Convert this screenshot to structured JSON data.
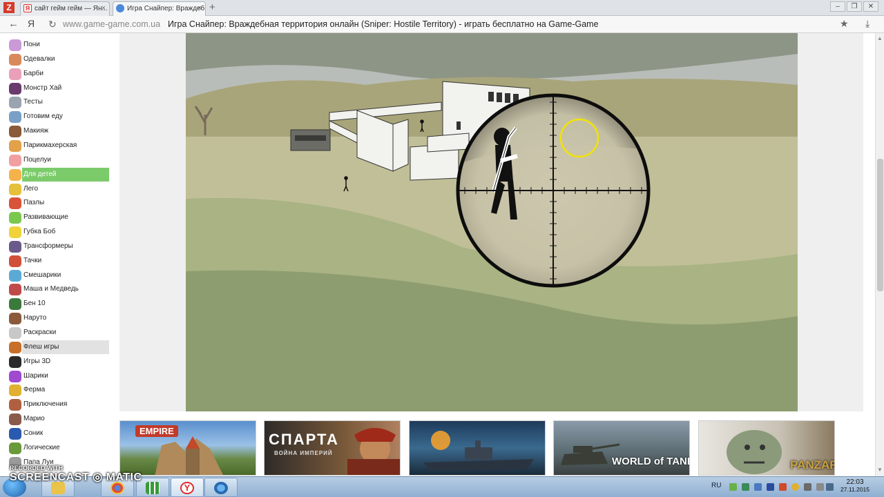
{
  "browser": {
    "tabs": [
      {
        "label": "сайт гейм гейм — Ян..."
      },
      {
        "label": "Игра Снайпер: Враждеб"
      }
    ],
    "url": "www.game-game.com.ua",
    "page_title": "Игра Снайпер: Враждебная территория онлайн (Sniper: Hostile Territory) - играть бесплатно на Game-Game"
  },
  "sidebar": {
    "items": [
      {
        "label": "Пони",
        "icon": "pony-icon",
        "color": "#c99ad6"
      },
      {
        "label": "Одевалки",
        "icon": "dress-up-icon",
        "color": "#d98a5a"
      },
      {
        "label": "Барби",
        "icon": "barbie-icon",
        "color": "#e9a0b8"
      },
      {
        "label": "Монстр Хай",
        "icon": "monster-high-icon",
        "color": "#6a3a6e"
      },
      {
        "label": "Тесты",
        "icon": "tests-icon",
        "color": "#9aa4b0"
      },
      {
        "label": "Готовим еду",
        "icon": "cooking-icon",
        "color": "#7aa0c8"
      },
      {
        "label": "Макияж",
        "icon": "makeup-icon",
        "color": "#8a5a3a"
      },
      {
        "label": "Парикмахерская",
        "icon": "scissors-icon",
        "color": "#e3a14a"
      },
      {
        "label": "Поцелуи",
        "icon": "kisses-icon",
        "color": "#f0a0a0"
      },
      {
        "label": "Для детей",
        "icon": "kids-icon",
        "color": "#f4b24a"
      },
      {
        "label": "Лего",
        "icon": "lego-icon",
        "color": "#e5c03a"
      },
      {
        "label": "Пазлы",
        "icon": "puzzle-icon",
        "color": "#d9533a"
      },
      {
        "label": "Развивающие",
        "icon": "educational-icon",
        "color": "#7bc84e"
      },
      {
        "label": "Губка Боб",
        "icon": "spongebob-icon",
        "color": "#f0d33a"
      },
      {
        "label": "Трансформеры",
        "icon": "transformers-icon",
        "color": "#6a5a8a"
      },
      {
        "label": "Тачки",
        "icon": "cars-icon",
        "color": "#d0503a"
      },
      {
        "label": "Смешарики",
        "icon": "smeshariki-icon",
        "color": "#5aaad8"
      },
      {
        "label": "Маша и Медведь",
        "icon": "masha-icon",
        "color": "#c04a4a"
      },
      {
        "label": "Бен 10",
        "icon": "ben10-icon",
        "color": "#3a7a3a"
      },
      {
        "label": "Наруто",
        "icon": "naruto-icon",
        "color": "#8a5a3a"
      },
      {
        "label": "Раскраски",
        "icon": "coloring-icon",
        "color": "#c8c8c8"
      },
      {
        "label": "Флеш игры",
        "icon": "flash-games-icon",
        "color": "#c8702a"
      },
      {
        "label": "Игры 3D",
        "icon": "3d-games-icon",
        "color": "#2a2a2a"
      },
      {
        "label": "Шарики",
        "icon": "balls-icon",
        "color": "#a04ad0"
      },
      {
        "label": "Ферма",
        "icon": "farm-icon",
        "color": "#e0b030"
      },
      {
        "label": "Приключения",
        "icon": "adventure-icon",
        "color": "#b06040"
      },
      {
        "label": "Марио",
        "icon": "mario-icon",
        "color": "#8a5a4a"
      },
      {
        "label": "Соник",
        "icon": "sonic-icon",
        "color": "#2a5ab0"
      },
      {
        "label": "Логические",
        "icon": "logic-icon",
        "color": "#6a9a3a"
      },
      {
        "label": "Папа Луи",
        "icon": "papa-louie-icon",
        "color": "#9a9a9a"
      }
    ],
    "active": "Для детей",
    "hovered": "Флеш игры"
  },
  "thumbnails": [
    {
      "label": "EMPIRE",
      "name": "empire"
    },
    {
      "label": "СПАРТА",
      "sub": "ВОЙНА ИМПЕРИЙ",
      "name": "sparta"
    },
    {
      "label": "",
      "name": "battleships"
    },
    {
      "label": "WORLD of TANKS",
      "name": "world-of-tanks"
    },
    {
      "label": "PANZAR",
      "name": "panzar"
    }
  ],
  "watermark": {
    "line1": "RECORDED WITH",
    "line2": "SCREENCAST ◎ MATIC"
  },
  "tray": {
    "lang": "RU",
    "time": "22:03",
    "date": "27.11.2015"
  }
}
